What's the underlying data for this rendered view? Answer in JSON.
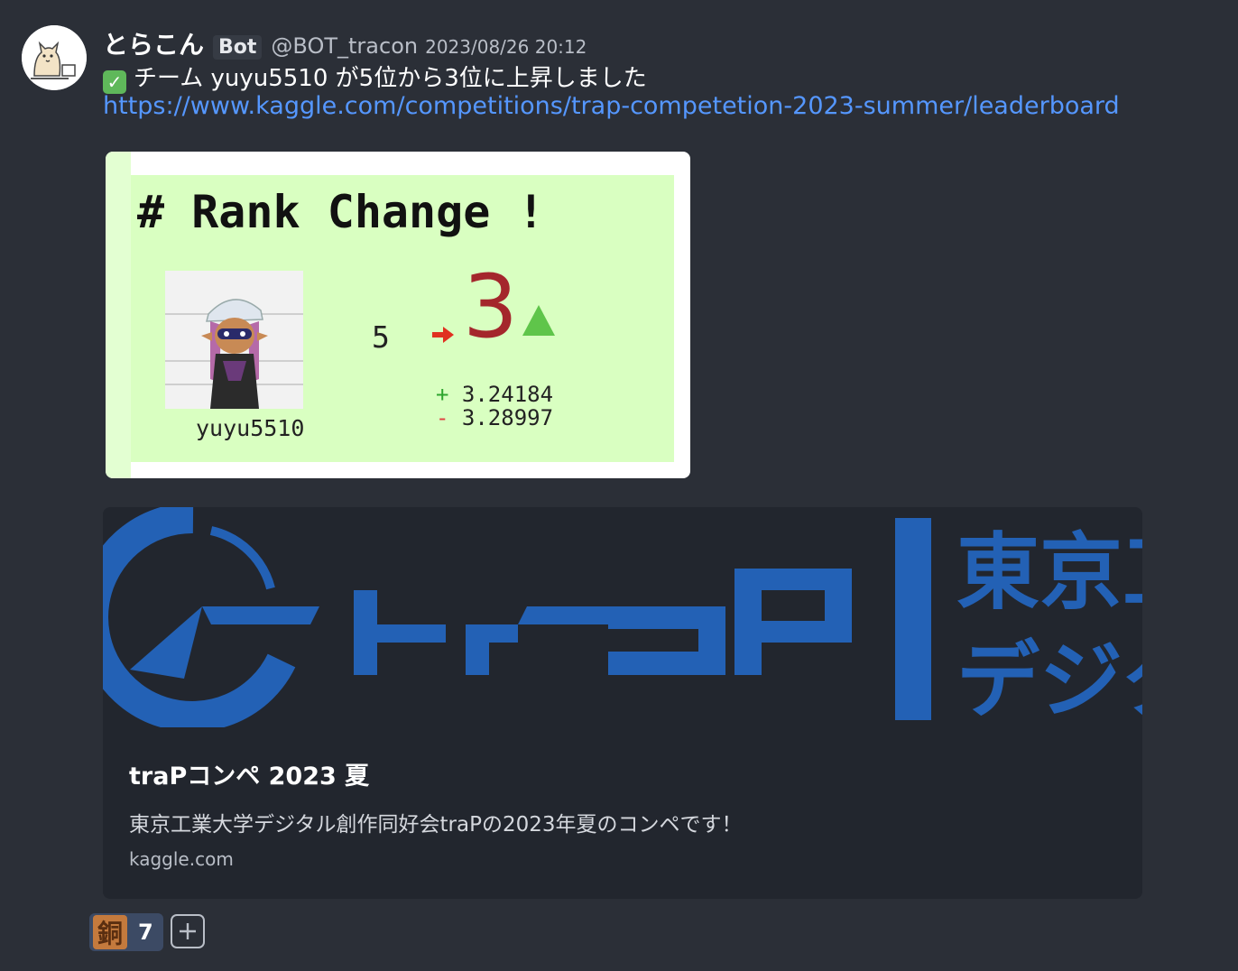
{
  "message": {
    "author_name": "とらこん",
    "bot_badge": "Bot",
    "handle": "@BOT_tracon",
    "timestamp": "2023/08/26 20:12",
    "text": "チーム yuyu5510 が5位から3位に上昇しました",
    "check_icon": "check-mark-icon",
    "link": "https://www.kaggle.com/competitions/trap-competetion-2023-summer/leaderboard"
  },
  "rank_image": {
    "title": "# Rank Change !",
    "user": "yuyu5510",
    "old_rank": "5",
    "new_rank": "3",
    "score_plus": "3.24184",
    "score_minus": "3.28997",
    "plus_sign": "+",
    "minus_sign": "-",
    "colors": {
      "background": "#d9ffc1",
      "new_rank": "#a4262c",
      "arrow": "#e03020",
      "up": "#5fc54a"
    }
  },
  "embed": {
    "banner_logo": "traP",
    "banner_text_1": "東京工",
    "banner_text_2": "デジタ",
    "title": "traPコンペ 2023 夏",
    "description": "東京工業大学デジタル創作同好会traPの2023年夏のコンペです！",
    "domain": "kaggle.com",
    "banner_color": "#2361b5"
  },
  "reactions": [
    {
      "stamp": "銅",
      "count": "7"
    }
  ],
  "add_reaction_icon": "add-stamp-icon"
}
